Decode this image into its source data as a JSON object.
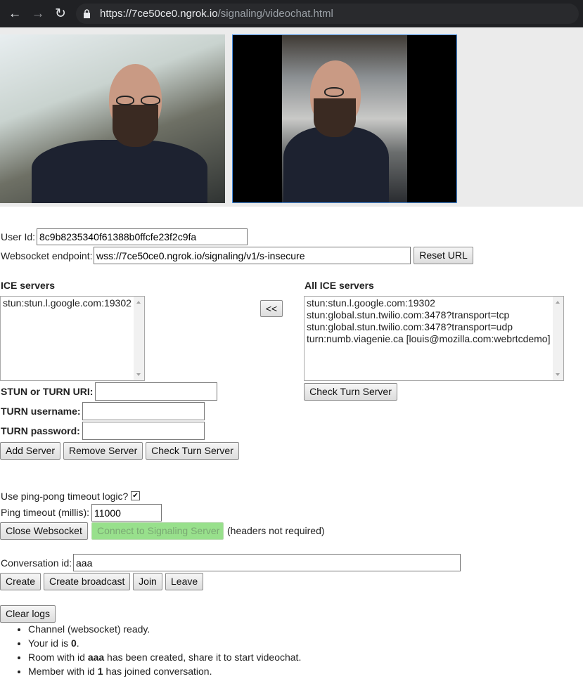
{
  "browser": {
    "url_host": "https://7ce50ce0.ngrok.io",
    "url_path": "/signaling/videochat.html"
  },
  "user": {
    "label": "User Id:",
    "value": "8c9b8235340f61388b0ffcfe23f2c9fa"
  },
  "websocket": {
    "label": "Websocket endpoint:",
    "value": "wss://7ce50ce0.ngrok.io/signaling/v1/s-insecure",
    "reset_label": "Reset URL"
  },
  "ice": {
    "title": "ICE servers",
    "selected": [
      "stun:stun.l.google.com:19302"
    ],
    "move_label": "<<",
    "all_title": "All ICE servers",
    "all": [
      "stun:stun.l.google.com:19302",
      "stun:global.stun.twilio.com:3478?transport=tcp",
      "stun:global.stun.twilio.com:3478?transport=udp",
      "turn:numb.viagenie.ca [louis@mozilla.com:webrtcdemo]"
    ],
    "check_turn_label": "Check Turn Server"
  },
  "server_form": {
    "uri_label": "STUN or TURN URI:",
    "username_label": "TURN username:",
    "password_label": "TURN password:",
    "add_label": "Add Server",
    "remove_label": "Remove Server",
    "check_label": "Check Turn Server"
  },
  "pingpong": {
    "label": "Use ping-pong timeout logic?",
    "checked": true,
    "timeout_label": "Ping timeout (millis):",
    "timeout_value": "11000"
  },
  "connection": {
    "close_label": "Close Websocket",
    "connect_label": "Connect to Signaling Server",
    "note": "(headers not required)"
  },
  "conversation": {
    "label": "Conversation id:",
    "value": "aaa",
    "create_label": "Create",
    "broadcast_label": "Create broadcast",
    "join_label": "Join",
    "leave_label": "Leave"
  },
  "logs": {
    "clear_label": "Clear logs",
    "entries": [
      {
        "pre": "Channel (websocket) ready.",
        "bold": "",
        "post": ""
      },
      {
        "pre": "Your id is ",
        "bold": "0",
        "post": "."
      },
      {
        "pre": "Room with id ",
        "bold": "aaa",
        "post": " has been created, share it to start videochat."
      },
      {
        "pre": "Member with id ",
        "bold": "1",
        "post": " has joined conversation."
      }
    ]
  },
  "colors": {
    "browser_bar": "#202124",
    "connect_disabled_bg": "#98e08c",
    "video_border": "#4a90e2"
  }
}
